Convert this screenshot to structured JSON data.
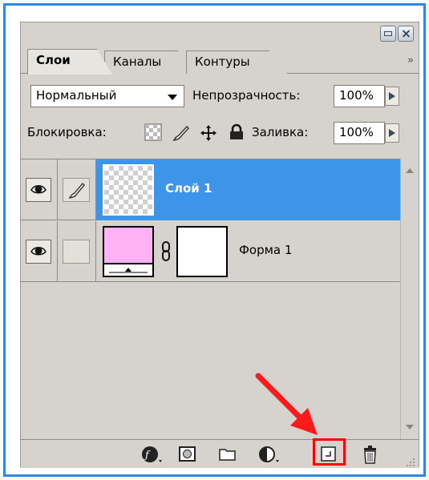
{
  "tabs": [
    {
      "label": "Слои",
      "active": true
    },
    {
      "label": "Каналы",
      "active": false
    },
    {
      "label": "Контуры",
      "active": false
    }
  ],
  "tabs_menu_glyph": "»",
  "blend_mode": {
    "value": "Нормальный"
  },
  "opacity": {
    "label": "Непрозрачность:",
    "value": "100%"
  },
  "lock": {
    "label": "Блокировка:"
  },
  "fill": {
    "label": "Заливка:",
    "value": "100%"
  },
  "layers": [
    {
      "name": "Слой 1",
      "selected": true
    },
    {
      "name": "Форма 1",
      "selected": false
    }
  ],
  "colors": {
    "frame": "#2f86e4",
    "panel_bg": "#d6d3ce",
    "selection": "#3d95ea",
    "shape_fill": "#ffb3f5",
    "annotation_red": "#ff0000"
  },
  "icons": {
    "minimize": "minimize-icon",
    "close": "close-icon",
    "visibility": "eye-icon",
    "brush": "brush-icon",
    "link": "chain-link-icon",
    "fx": "fx-icon",
    "mask": "mask-icon",
    "group": "folder-icon",
    "adjustment": "adjustment-icon",
    "new_layer": "new-layer-icon",
    "delete": "trash-icon"
  }
}
